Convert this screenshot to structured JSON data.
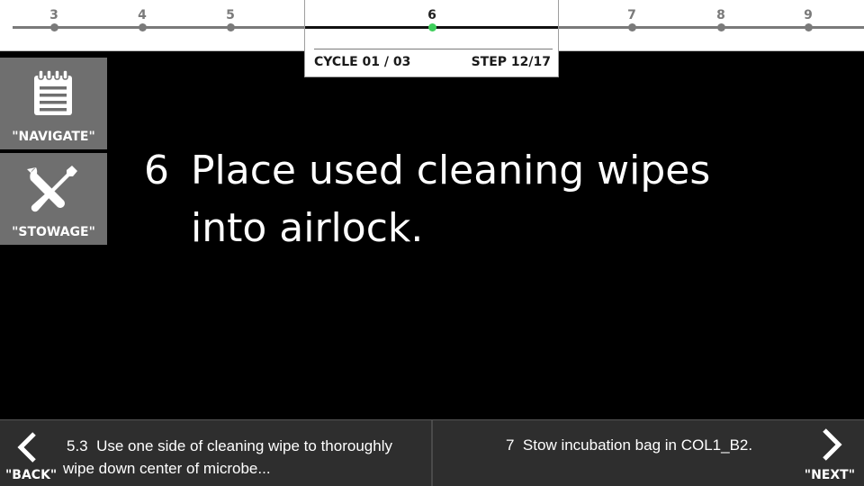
{
  "timeline": {
    "ticks": [
      {
        "label": "3",
        "current": false
      },
      {
        "label": "4",
        "current": false
      },
      {
        "label": "5",
        "current": false
      },
      {
        "label": "6",
        "current": true
      },
      {
        "label": "7",
        "current": false
      },
      {
        "label": "8",
        "current": false
      },
      {
        "label": "9",
        "current": false
      }
    ],
    "cycle": "CYCLE 01 / 03",
    "step": "STEP 12/17"
  },
  "side_buttons": {
    "navigate_label": "\"NAVIGATE\"",
    "navigate_icon": "notepad-icon",
    "stowage_label": "\"STOWAGE\"",
    "stowage_icon": "wrench-screwdriver-icon"
  },
  "instruction": {
    "number": "6",
    "text": "Place used cleaning wipes into airlock."
  },
  "bottom_nav": {
    "back_label": "\"BACK\"",
    "prev_number": "5.3",
    "prev_text": "Use one side of cleaning wipe to thoroughly wipe down center of microbe...",
    "next_number": "7",
    "next_text": "Stow incubation bag in COL1_B2.",
    "next_label": "\"NEXT\""
  },
  "colors": {
    "current_dot": "#3ecf5b",
    "tile_bg": "#6f6f6f",
    "bottom_bg": "#2e2e2e"
  }
}
